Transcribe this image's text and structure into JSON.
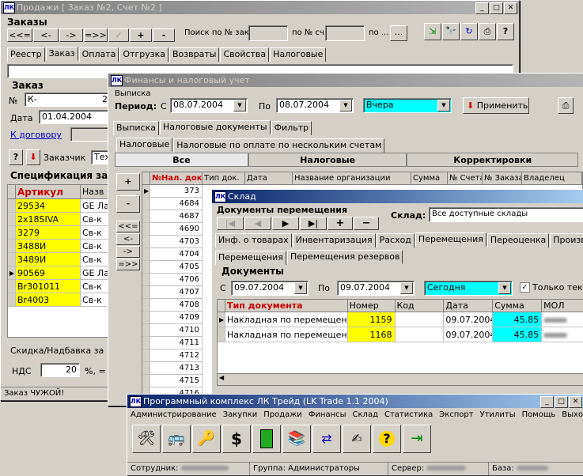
{
  "win_sales": {
    "title": "Продажи [ Заказ №2, Счет №2 ]",
    "orders_label": "Заказы",
    "nav_buttons": [
      "<<=",
      "<-",
      "->",
      "=>>",
      "",
      "+",
      "-"
    ],
    "search_order_label": "Поиск по № зак.",
    "search_invoice_label": "по № сч.",
    "search_by_label": "по ...",
    "ellipsis": "...",
    "help": "?",
    "tabs": [
      "Реестр",
      "Заказ",
      "Оплата",
      "Отгрузка",
      "Возвраты",
      "Свойства",
      "Налоговые"
    ],
    "order_group": "Заказ",
    "num_label": "№",
    "num_value": "К-",
    "num_value2": "2",
    "date_label": "Дата",
    "date_value": "01.04.2004",
    "contract_link": "К договору",
    "client_label": "Заказчик",
    "client_value": "Тех",
    "spec_label": "Спецификация за",
    "spec_headers": [
      "Артикул",
      "Назв"
    ],
    "spec_rows": [
      {
        "art": "29534",
        "name": "GE Ла"
      },
      {
        "art": "2x18SIVA",
        "name": "Св-к"
      },
      {
        "art": "3279",
        "name": "Св-к"
      },
      {
        "art": "3488И",
        "name": "Св-к"
      },
      {
        "art": "3489И",
        "name": "Св-к"
      },
      {
        "art": "90569",
        "name": "GE Ла"
      },
      {
        "art": "Br301011",
        "name": "Св-к"
      },
      {
        "art": "Br4003",
        "name": "Св-к"
      }
    ],
    "discount_label": "Скидка/Надбавка за",
    "vat_label": "НДС",
    "vat_value": "20",
    "vat_unit": "%, =",
    "status": "Заказ ЧУЖОЙ!"
  },
  "win_finance": {
    "title": "Финансы и налоговый учет",
    "group": "Выписка",
    "period_label": "Период:",
    "from_label": "С",
    "from_value": "08.07.2004",
    "to_label": "По",
    "to_value": "08.07.2004",
    "preset": "Вчера",
    "apply": "Применить",
    "tabs": [
      "Выписка",
      "Налоговые документы",
      "Фильтр"
    ],
    "subtabs": [
      "Налоговые",
      "Налоговые по оплате по нескольким счетам"
    ],
    "bands": [
      "Все",
      "Налоговые",
      "Корректировки"
    ],
    "side_buttons": [
      "+",
      "-",
      "<<=",
      "<-",
      "->",
      "=>>"
    ],
    "headers": [
      "№Нал. док.",
      "Тип док.",
      "Дата",
      "Название организации",
      "Сумма",
      "№ Счета",
      "№ Заказа",
      "Владелец"
    ],
    "rows": [
      "373",
      "4684",
      "4687",
      "4690",
      "4703",
      "4704",
      "4705",
      "4706",
      "4707",
      "4708",
      "4709",
      "4710",
      "4711",
      "4712",
      "4713",
      "4715",
      "4716"
    ]
  },
  "win_warehouse": {
    "title": "Склад",
    "docs_label": "Документы перемещения",
    "warehouse_label": "Склад:",
    "warehouse_value": "Все доступные склады",
    "tabs": [
      "Инф. о товарах",
      "Инвентаризация",
      "Расход",
      "Перемещения",
      "Переоценка",
      "Производство"
    ],
    "subtabs": [
      "Перемещения",
      "Перемещения резервов"
    ],
    "docs_group": "Документы",
    "from_label": "С",
    "from_value": "09.07.2004",
    "to_label": "По",
    "to_value": "09.07.2004",
    "preset": "Сегодня",
    "only_label": "Только тек",
    "headers": [
      "Тип документа",
      "Номер",
      "Код",
      "Дата",
      "Сумма",
      "МОЛ"
    ],
    "rows": [
      {
        "type": "Накладная по перемещен",
        "num": "1159",
        "code": "",
        "date": "09.07.2004",
        "sum": "45.85"
      },
      {
        "type": "Накладная по перемещен",
        "num": "1168",
        "code": "",
        "date": "09.07.2004",
        "sum": "45.85"
      }
    ]
  },
  "win_main": {
    "title": "Программный комплекс ЛК Трейд (LK Trade 1.1 2004)",
    "menu": [
      "Администрирование",
      "Закупки",
      "Продажи",
      "Финансы",
      "Склад",
      "Статистика",
      "Экспорт",
      "Утилиты",
      "Помощь",
      "Выход"
    ],
    "tools": [
      "tools-icon",
      "bus-icon",
      "keys-icon",
      "dollar-icon",
      "cabinet-icon",
      "books-icon",
      "exchange-icon",
      "stamp-icon",
      "help-icon",
      "exit-icon"
    ],
    "dollar": "$",
    "question": "?",
    "status_user_label": "Сотрудник:",
    "status_group_label": "Группа:",
    "status_group_value": "Администраторы",
    "status_server_label": "Сервер:",
    "status_db_label": "База:"
  },
  "colors": {
    "yellow": "#ffff00",
    "cyan": "#00ffff",
    "red": "#cc0000",
    "title_active": "#0a246a"
  }
}
